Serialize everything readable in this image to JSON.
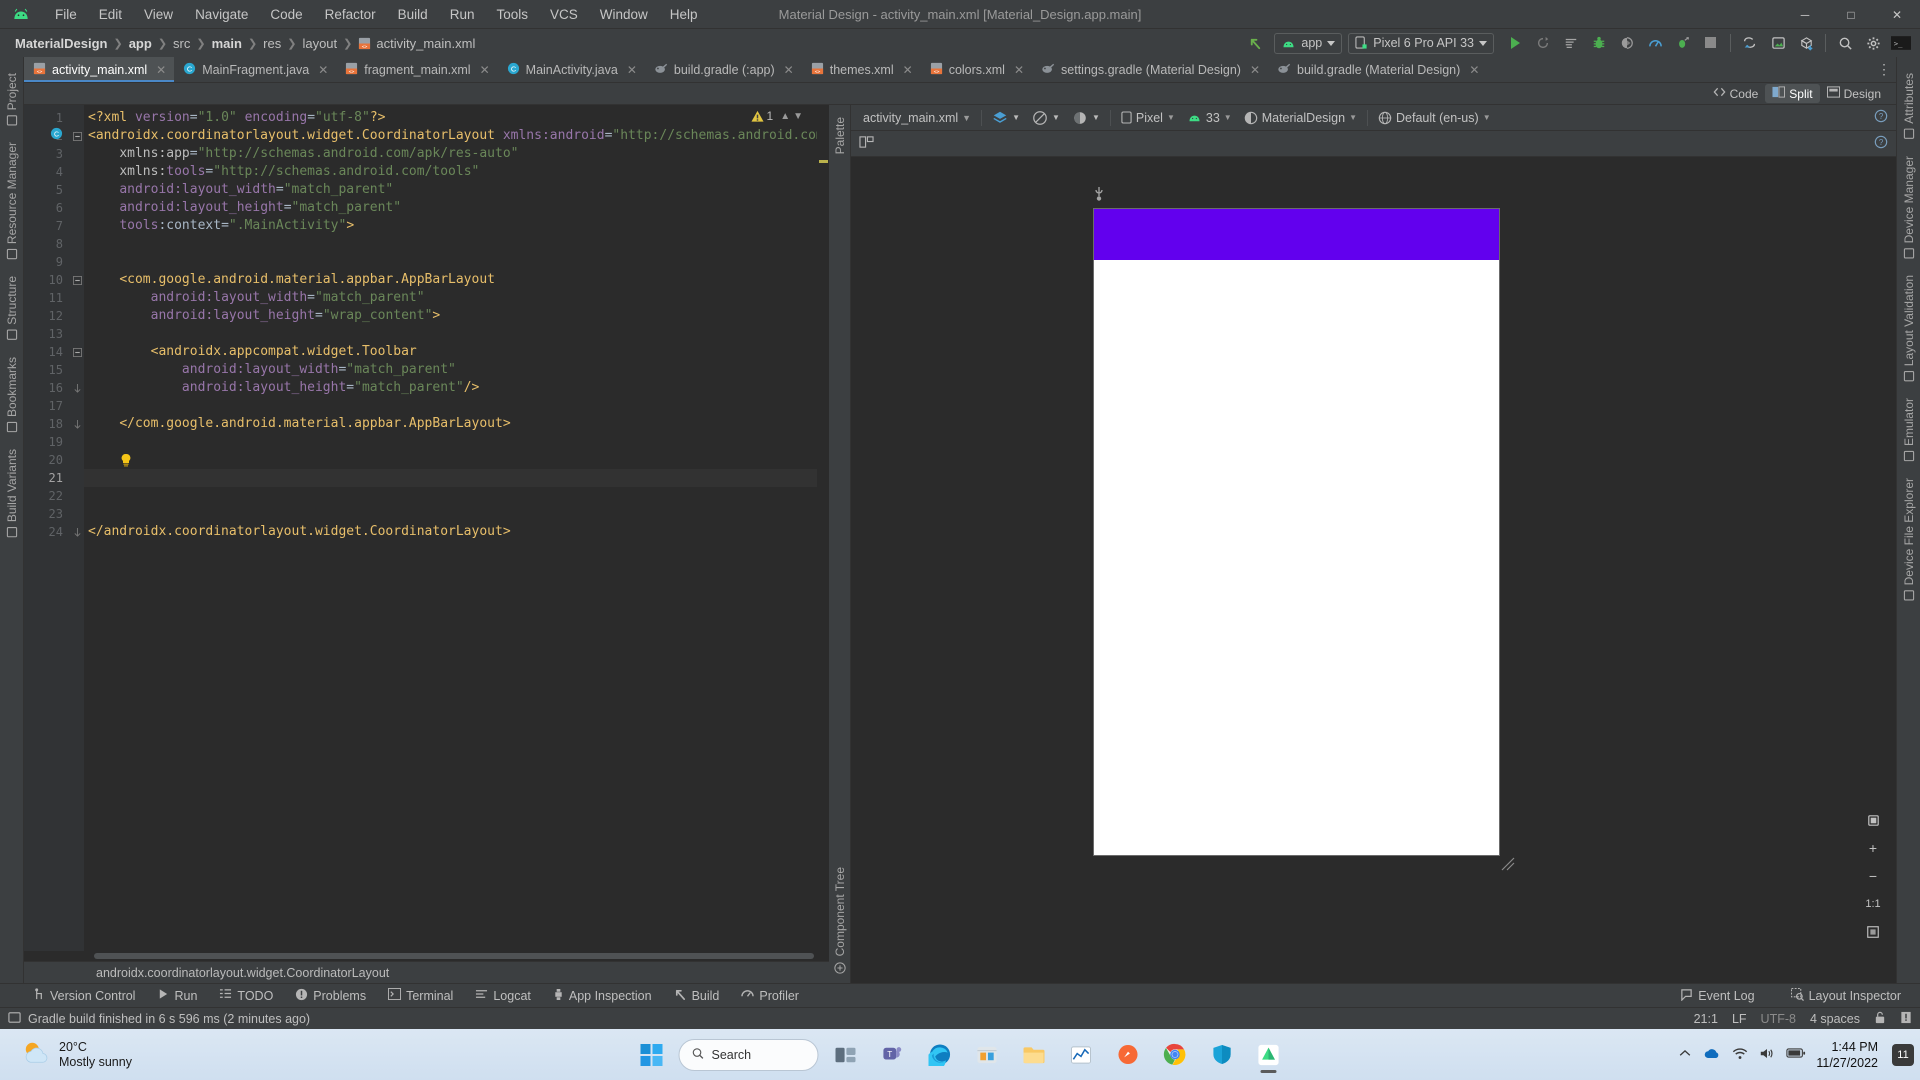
{
  "window": {
    "title": "Material Design - activity_main.xml [Material_Design.app.main]",
    "minimize": "─",
    "maximize": "□",
    "close": "✕"
  },
  "menubar": {
    "items": [
      "File",
      "Edit",
      "View",
      "Navigate",
      "Code",
      "Refactor",
      "Build",
      "Run",
      "Tools",
      "VCS",
      "Window",
      "Help"
    ]
  },
  "breadcrumbs": [
    {
      "label": "MaterialDesign",
      "bold": true
    },
    {
      "label": "app",
      "bold": true
    },
    {
      "label": "src",
      "bold": false
    },
    {
      "label": "main",
      "bold": true
    },
    {
      "label": "res",
      "bold": false
    },
    {
      "label": "layout",
      "bold": false
    },
    {
      "label": "activity_main.xml",
      "bold": false
    }
  ],
  "toolbar": {
    "module_selector": "app",
    "device_selector": "Pixel 6 Pro API 33",
    "icons": [
      "back-arrow-icon",
      "run-icon",
      "rerun-icon",
      "run-with-coverage-icon",
      "debug-icon",
      "profile-icon",
      "attach-debugger-icon",
      "stop-icon",
      "sync-gradle-icon",
      "avd-manager-icon",
      "sdk-manager-icon",
      "search-icon",
      "settings-icon",
      "terminal-icon"
    ]
  },
  "editor_tabs": [
    {
      "label": "activity_main.xml",
      "icon": "xml-layout-icon",
      "active": true
    },
    {
      "label": "MainFragment.java",
      "icon": "java-class-icon",
      "active": false
    },
    {
      "label": "fragment_main.xml",
      "icon": "xml-layout-icon",
      "active": false
    },
    {
      "label": "MainActivity.java",
      "icon": "java-class-icon",
      "active": false
    },
    {
      "label": "build.gradle (:app)",
      "icon": "gradle-icon",
      "active": false
    },
    {
      "label": "themes.xml",
      "icon": "xml-values-icon",
      "active": false
    },
    {
      "label": "colors.xml",
      "icon": "xml-values-icon",
      "active": false
    },
    {
      "label": "settings.gradle (Material Design)",
      "icon": "gradle-icon",
      "active": false
    },
    {
      "label": "build.gradle (Material Design)",
      "icon": "gradle-icon",
      "active": false
    }
  ],
  "left_tool_tabs": [
    {
      "label": "Project",
      "icon": "project-icon"
    },
    {
      "label": "Resource Manager",
      "icon": "resource-manager-icon"
    },
    {
      "label": "Structure",
      "icon": "structure-icon"
    },
    {
      "label": "Bookmarks",
      "icon": "bookmarks-icon"
    },
    {
      "label": "Build Variants",
      "icon": "build-variants-icon"
    }
  ],
  "right_tool_tabs": [
    {
      "label": "Attributes",
      "icon": "attributes-icon"
    },
    {
      "label": "Device Manager",
      "icon": "device-manager-icon"
    },
    {
      "label": "Layout Validation",
      "icon": "layout-validation-icon"
    },
    {
      "label": "Emulator",
      "icon": "emulator-icon"
    },
    {
      "label": "Device File Explorer",
      "icon": "device-file-explorer-icon"
    }
  ],
  "editor": {
    "warning_count": "1",
    "warning_icon": "warning-triangle-icon",
    "breadcrumb_status": "androidx.coordinatorlayout.widget.CoordinatorLayout",
    "lines": [
      {
        "n": 1,
        "segments": [
          {
            "t": "<?xml ",
            "c": "tag"
          },
          {
            "t": "version",
            "c": "attr"
          },
          {
            "t": "=",
            "c": "eq"
          },
          {
            "t": "\"1.0\"",
            "c": "val"
          },
          {
            "t": " ",
            "c": "pnct"
          },
          {
            "t": "encoding",
            "c": "attr"
          },
          {
            "t": "=",
            "c": "eq"
          },
          {
            "t": "\"utf-8\"",
            "c": "val"
          },
          {
            "t": "?>",
            "c": "tag"
          }
        ],
        "indent": 0
      },
      {
        "n": 2,
        "segments": [
          {
            "t": "<androidx.coordinatorlayout.widget.CoordinatorLayout ",
            "c": "tag"
          },
          {
            "t": "xmlns:android",
            "c": "attr"
          },
          {
            "t": "=",
            "c": "eq"
          },
          {
            "t": "\"http://schemas.android.com/apk/res/android\"",
            "c": "val"
          }
        ],
        "indent": 0
      },
      {
        "n": 3,
        "segments": [
          {
            "t": "xmlns:app",
            "c": "ns"
          },
          {
            "t": "=",
            "c": "eq"
          },
          {
            "t": "\"http://schemas.android.com/apk/res-auto\"",
            "c": "val"
          }
        ],
        "indent": 4
      },
      {
        "n": 4,
        "segments": [
          {
            "t": "xmlns:",
            "c": "ns"
          },
          {
            "t": "tools",
            "c": "attr"
          },
          {
            "t": "=",
            "c": "eq"
          },
          {
            "t": "\"http://schemas.android.com/tools\"",
            "c": "val"
          }
        ],
        "indent": 4
      },
      {
        "n": 5,
        "segments": [
          {
            "t": "android:layout_width",
            "c": "attr"
          },
          {
            "t": "=",
            "c": "eq"
          },
          {
            "t": "\"match_parent\"",
            "c": "val"
          }
        ],
        "indent": 4
      },
      {
        "n": 6,
        "segments": [
          {
            "t": "android:layout_height",
            "c": "attr"
          },
          {
            "t": "=",
            "c": "eq"
          },
          {
            "t": "\"match_parent\"",
            "c": "val"
          }
        ],
        "indent": 4
      },
      {
        "n": 7,
        "segments": [
          {
            "t": "tools",
            "c": "attr"
          },
          {
            "t": ":context=",
            "c": "eq"
          },
          {
            "t": "\".MainActivity\"",
            "c": "val"
          },
          {
            "t": ">",
            "c": "tag"
          }
        ],
        "indent": 4
      },
      {
        "n": 8,
        "segments": [],
        "indent": 0
      },
      {
        "n": 9,
        "segments": [],
        "indent": 0
      },
      {
        "n": 10,
        "segments": [
          {
            "t": "<com.google.android.material.appbar.AppBarLayout",
            "c": "tag"
          }
        ],
        "indent": 4
      },
      {
        "n": 11,
        "segments": [
          {
            "t": "android:layout_width",
            "c": "attr"
          },
          {
            "t": "=",
            "c": "eq"
          },
          {
            "t": "\"match_parent\"",
            "c": "val"
          }
        ],
        "indent": 8
      },
      {
        "n": 12,
        "segments": [
          {
            "t": "android:layout_height",
            "c": "attr"
          },
          {
            "t": "=",
            "c": "eq"
          },
          {
            "t": "\"wrap_content\"",
            "c": "val"
          },
          {
            "t": ">",
            "c": "tag"
          }
        ],
        "indent": 8
      },
      {
        "n": 13,
        "segments": [],
        "indent": 0
      },
      {
        "n": 14,
        "segments": [
          {
            "t": "<androidx.appcompat.widget.Toolbar",
            "c": "tag"
          }
        ],
        "indent": 8
      },
      {
        "n": 15,
        "segments": [
          {
            "t": "android:layout_width",
            "c": "attr"
          },
          {
            "t": "=",
            "c": "eq"
          },
          {
            "t": "\"match_parent\"",
            "c": "val"
          }
        ],
        "indent": 12
      },
      {
        "n": 16,
        "segments": [
          {
            "t": "android:layout_height",
            "c": "attr"
          },
          {
            "t": "=",
            "c": "eq"
          },
          {
            "t": "\"match_parent\"",
            "c": "val"
          },
          {
            "t": "/>",
            "c": "tag"
          }
        ],
        "indent": 12
      },
      {
        "n": 17,
        "segments": [],
        "indent": 0
      },
      {
        "n": 18,
        "segments": [
          {
            "t": "</com.google.android.material.appbar.AppBarLayout>",
            "c": "tag"
          }
        ],
        "indent": 4
      },
      {
        "n": 19,
        "segments": [],
        "indent": 0
      },
      {
        "n": 20,
        "segments": [],
        "indent": 0
      },
      {
        "n": 21,
        "segments": [],
        "indent": 0
      },
      {
        "n": 22,
        "segments": [],
        "indent": 0
      },
      {
        "n": 23,
        "segments": [],
        "indent": 0
      },
      {
        "n": 24,
        "segments": [
          {
            "t": "</androidx.coordinatorlayout.widget.CoordinatorLayout>",
            "c": "tag"
          }
        ],
        "indent": 0
      }
    ]
  },
  "design": {
    "mode_tabs": [
      {
        "label": "Code",
        "icon": "code-mode-icon",
        "selected": false
      },
      {
        "label": "Split",
        "icon": "split-mode-icon",
        "selected": true
      },
      {
        "label": "Design",
        "icon": "design-mode-icon",
        "selected": false
      }
    ],
    "palette_label": "Palette",
    "component_tree_label": "Component Tree",
    "toolbar": {
      "file_selector": "activity_main.xml",
      "design_surface_icon": "design-surface-icon",
      "blueprint_icon": "blueprint-toggle-icon",
      "theme_ui_icon": "night-mode-icon",
      "device": "Pixel",
      "api_level": "33",
      "theme": "MaterialDesign",
      "locale": "Default (en-us)",
      "help_icon": "help-icon",
      "warning_icon": "inspection-warning-icon"
    },
    "zoom_controls": {
      "pan_icon": "pan-tool-icon",
      "zoom_in": "+",
      "zoom_out": "−",
      "zoom_actual": "1:1",
      "zoom_fit": "fit-to-screen-icon"
    },
    "preview": {
      "appbar_color": "#6200ee",
      "surface_color": "#ffffff"
    }
  },
  "tool_windows": [
    {
      "label": "Version Control",
      "icon": "version-control-icon"
    },
    {
      "label": "Run",
      "icon": "run-icon"
    },
    {
      "label": "TODO",
      "icon": "todo-icon"
    },
    {
      "label": "Problems",
      "icon": "problems-icon"
    },
    {
      "label": "Terminal",
      "icon": "terminal-icon"
    },
    {
      "label": "Logcat",
      "icon": "logcat-icon"
    },
    {
      "label": "App Inspection",
      "icon": "app-inspection-icon"
    },
    {
      "label": "Build",
      "icon": "build-icon"
    },
    {
      "label": "Profiler",
      "icon": "profiler-icon"
    }
  ],
  "tool_windows_right": [
    {
      "label": "Event Log",
      "icon": "event-log-icon"
    },
    {
      "label": "Layout Inspector",
      "icon": "layout-inspector-icon"
    }
  ],
  "statusbar": {
    "message": "Gradle build finished in 6 s 596 ms (2 minutes ago)",
    "message_icon": "build-status-icon",
    "caret": "21:1",
    "line_separator": "LF",
    "encoding": "UTF-8",
    "indent": "4 spaces",
    "lock_icon": "read-only-lock-icon",
    "inspection_icon": "inspections-icon"
  },
  "taskbar": {
    "weather": {
      "temp": "20°C",
      "desc": "Mostly sunny",
      "icon": "sun-cloud-icon"
    },
    "start_icon": "windows-start-icon",
    "search_placeholder": "Search",
    "search_icon": "search-icon",
    "apps": [
      {
        "name": "task-view-icon"
      },
      {
        "name": "teams-icon"
      },
      {
        "name": "edge-icon"
      },
      {
        "name": "store-icon"
      },
      {
        "name": "file-explorer-icon"
      },
      {
        "name": "charts-app-icon"
      },
      {
        "name": "postman-icon"
      },
      {
        "name": "chrome-icon"
      },
      {
        "name": "shield-app-icon"
      },
      {
        "name": "android-studio-icon"
      }
    ],
    "tray": {
      "chevron_up": "show-hidden-icons-icon",
      "onedrive": "onedrive-icon",
      "network": "wifi-icon",
      "volume": "volume-icon",
      "battery": "battery-icon"
    },
    "clock": {
      "time": "1:44 PM",
      "date": "11/27/2022"
    },
    "notification_count": "11"
  }
}
